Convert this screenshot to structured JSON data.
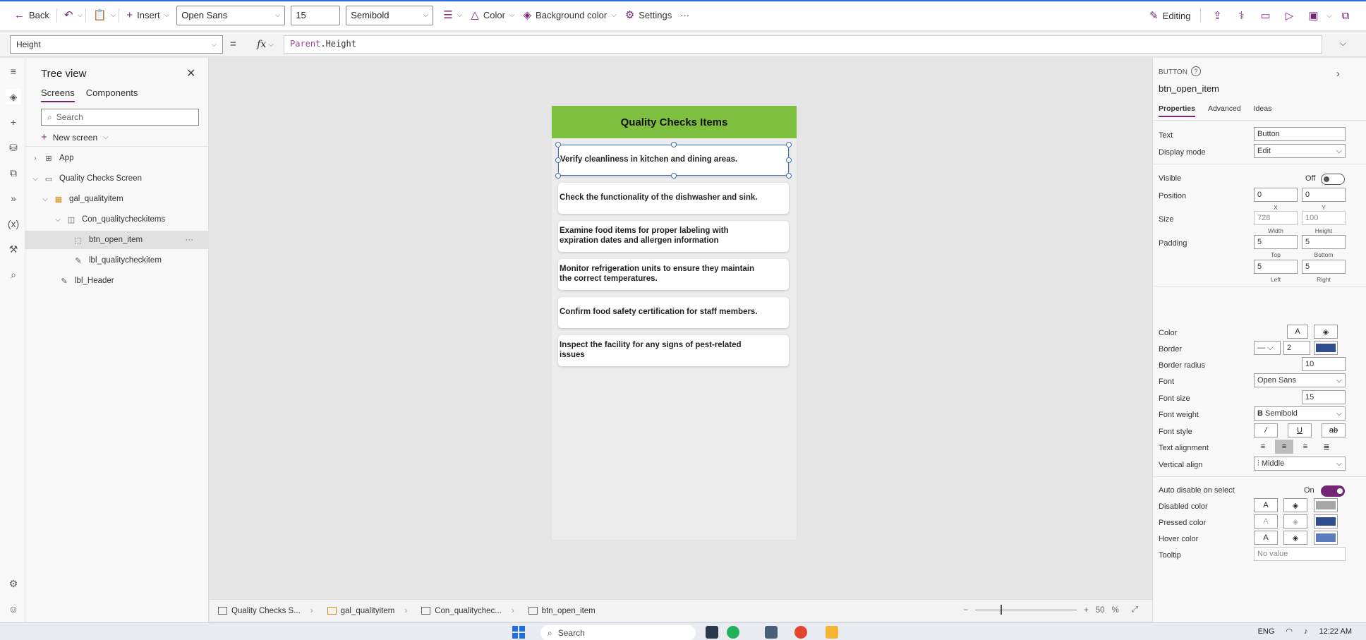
{
  "command_bar": {
    "back_label": "Back",
    "insert_label": "Insert",
    "font_value": "Open Sans",
    "font_size_value": "15",
    "font_weight_value": "Semibold",
    "color_label": "Color",
    "background_color_label": "Background color",
    "settings_label": "Settings",
    "more_label": "···",
    "editing_label": "Editing"
  },
  "formula_bar": {
    "property_value": "Height",
    "equals": "=",
    "fx_label": "fx",
    "formula_keyword": "Parent",
    "formula_rest": ".Height"
  },
  "tree_view": {
    "title": "Tree view",
    "tabs": [
      "Screens",
      "Components"
    ],
    "search_placeholder": "Search",
    "new_screen_label": "New screen",
    "nodes": [
      {
        "label": "App"
      },
      {
        "label": "Quality Checks Screen"
      },
      {
        "label": "gal_qualityitem"
      },
      {
        "label": "Con_qualitycheckitems"
      },
      {
        "label": "btn_open_item"
      },
      {
        "label": "lbl_qualitycheckitem"
      },
      {
        "label": "lbl_Header"
      }
    ]
  },
  "canvas": {
    "header_title": "Quality Checks Items",
    "items": [
      "Verify cleanliness in kitchen and dining areas.",
      "Check the functionality of the dishwasher and sink.",
      "Examine food items for proper labeling with expiration dates and allergen information",
      "Monitor refrigeration units to ensure they maintain the correct temperatures.",
      "Confirm food safety certification for staff members.",
      "Inspect the facility for any signs of pest-related issues"
    ],
    "header_color": "#7fbf3f"
  },
  "status_bar": {
    "crumbs": [
      "Quality Checks S...",
      "gal_qualityitem",
      "Con_qualitychec...",
      "btn_open_item"
    ],
    "zoom_minus": "−",
    "zoom_plus": "+",
    "zoom_value": "50",
    "zoom_unit": "%"
  },
  "properties": {
    "kind": "BUTTON",
    "control_name": "btn_open_item",
    "tabs": [
      "Properties",
      "Advanced",
      "Ideas"
    ],
    "text_label": "Text",
    "text_value": "Button",
    "display_mode_label": "Display mode",
    "display_mode_value": "Edit",
    "visible_label": "Visible",
    "visible_state": "Off",
    "position_label": "Position",
    "position_x": "0",
    "position_y": "0",
    "x_label": "X",
    "y_label": "Y",
    "size_label": "Size",
    "width_value": "728",
    "height_value": "100",
    "width_label": "Width",
    "height_label": "Height",
    "padding_label": "Padding",
    "padding_top": "5",
    "padding_bottom": "5",
    "padding_left": "5",
    "padding_right": "5",
    "top_label": "Top",
    "bottom_label": "Bottom",
    "left_label": "Left",
    "right_label": "Right",
    "color_label": "Color",
    "border_label": "Border",
    "border_width": "2",
    "border_color": "#2f4e8f",
    "border_radius_label": "Border radius",
    "border_radius_value": "10",
    "font_label": "Font",
    "font_value": "Open Sans",
    "font_size_label": "Font size",
    "font_size_value": "15",
    "font_weight_label": "Font weight",
    "font_weight_value": "Semibold",
    "font_style_label": "Font style",
    "text_alignment_label": "Text alignment",
    "vertical_align_label": "Vertical align",
    "vertical_align_value": "Middle",
    "auto_disable_label": "Auto disable on select",
    "auto_disable_state": "On",
    "disabled_color_label": "Disabled color",
    "pressed_color_label": "Pressed color",
    "hover_color_label": "Hover color",
    "tooltip_label": "Tooltip",
    "tooltip_placeholder": "No value",
    "accent_color": "#742774"
  },
  "taskbar": {
    "search_placeholder": "Search",
    "lang": "ENG",
    "time": "12:22 AM"
  }
}
